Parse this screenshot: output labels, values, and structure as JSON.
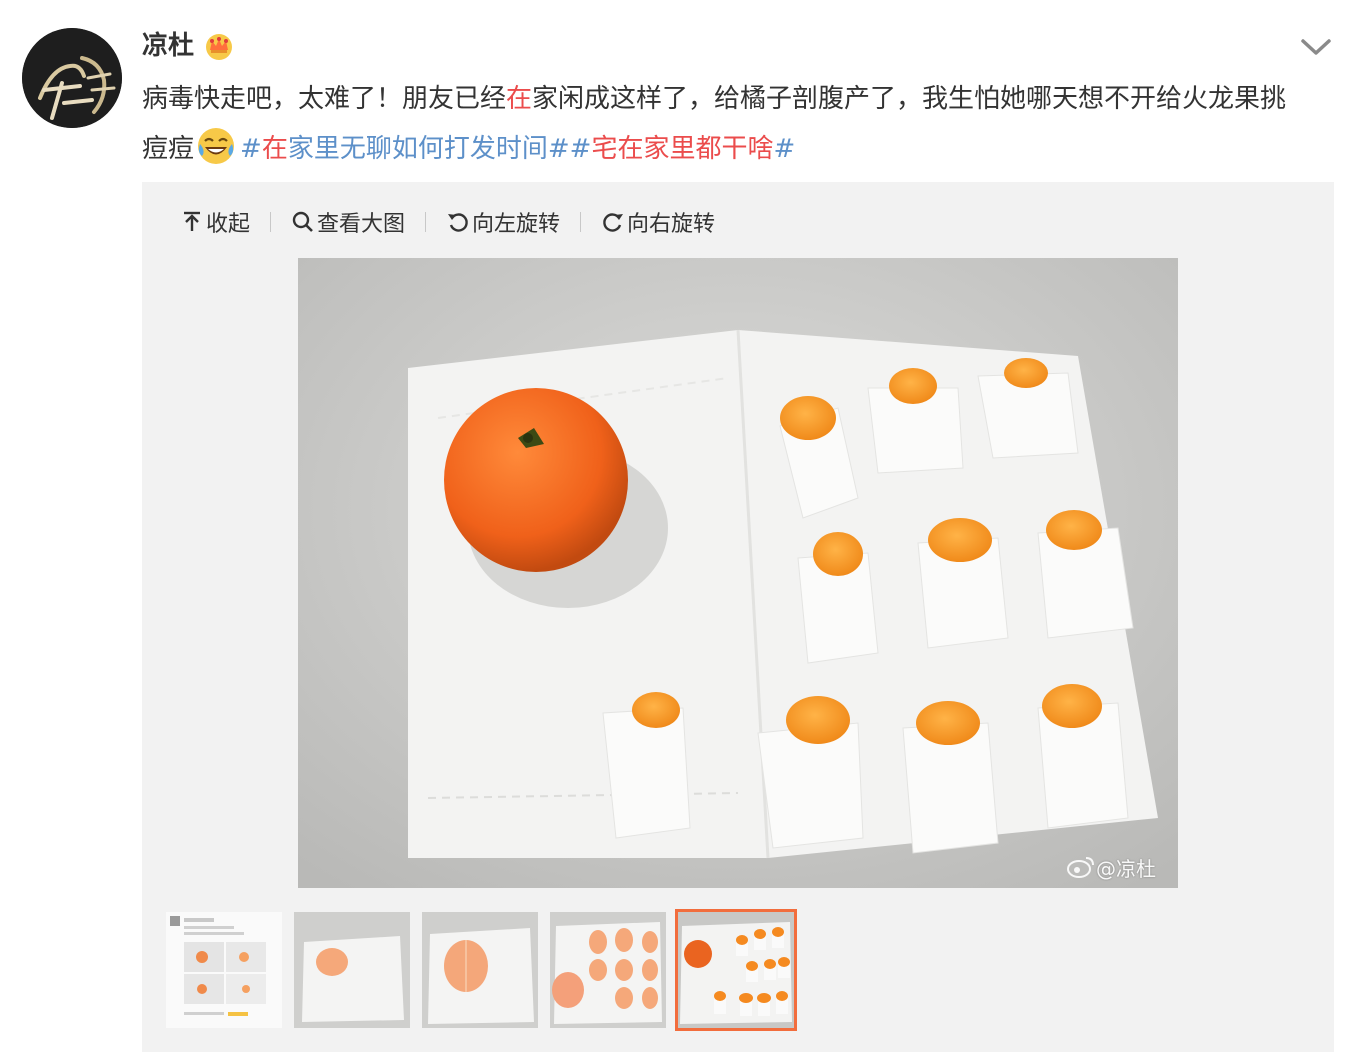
{
  "post": {
    "username": "凉杜",
    "text_part1": "病毒快走吧，太难了！朋友已经",
    "text_highlight": "在",
    "text_part2": "家闲成这样了，给橘子剖腹产了，我生怕她哪天想不开给火龙果挑痘痘",
    "hashtag1_open": "#",
    "hashtag1_hl": "在",
    "hashtag1_rest": "家里无聊如何打发时间",
    "hashtag1_close": "#",
    "hashtag2_open": "#",
    "hashtag2_text": "宅在家里都干啥",
    "hashtag2_close": "#"
  },
  "toolbar": {
    "collapse_label": "收起",
    "view_large_label": "查看大图",
    "rotate_left_label": "向左旋转",
    "rotate_right_label": "向右旋转"
  },
  "image": {
    "watermark": "@凉杜"
  },
  "thumbnails": [
    {
      "name": "thumb-1",
      "active": false
    },
    {
      "name": "thumb-2",
      "active": false
    },
    {
      "name": "thumb-3",
      "active": false
    },
    {
      "name": "thumb-4",
      "active": false
    },
    {
      "name": "thumb-5",
      "active": true
    }
  ],
  "colors": {
    "highlight": "#eb4c4c",
    "hashtag": "#5d90c9",
    "active_thumb_border": "#f26d3d",
    "media_bg": "#f2f2f2"
  }
}
